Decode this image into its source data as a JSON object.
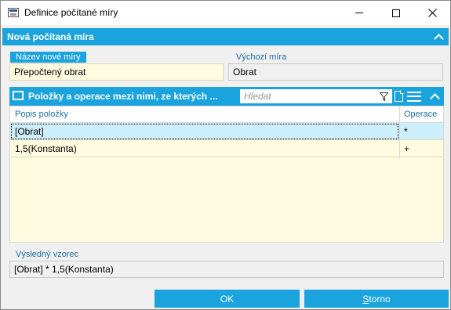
{
  "window": {
    "title": "Definice počítané míry",
    "icons": {
      "app": "app-window-icon",
      "minimize": "minimize-icon",
      "maximize": "maximize-icon",
      "close": "close-icon"
    }
  },
  "section": {
    "title": "Nová počítaná míra",
    "collapse_icon": "chevron-up-icon"
  },
  "form": {
    "new_name_label": "Název nové míry",
    "new_name_value": "Přepočtený obrat",
    "base_label": "Výchozí míra",
    "base_value": "Obrat"
  },
  "items_panel": {
    "title": "Položky a operace mezi nimi, ze kterých ...",
    "search_placeholder": "Hledat",
    "icons": [
      "book-icon",
      "filter-icon",
      "new-document-icon",
      "menu-icon",
      "chevron-up-icon"
    ],
    "columns": [
      "Popis položky",
      "Operace"
    ],
    "rows": [
      {
        "description": "[Obrat]",
        "operation": "*",
        "selected": true
      },
      {
        "description": "1,5(Konstanta)",
        "operation": "+",
        "selected": false
      }
    ]
  },
  "result": {
    "label": "Výsledný vzorec",
    "value": "[Obrat] * 1,5(Konstanta)"
  },
  "buttons": {
    "ok_label": "OK",
    "storno_first": "S",
    "storno_rest": "torno"
  },
  "colors": {
    "accent": "#1aa3dc",
    "editable_bg": "#fffbe0",
    "selected_row": "#cdeefc"
  }
}
